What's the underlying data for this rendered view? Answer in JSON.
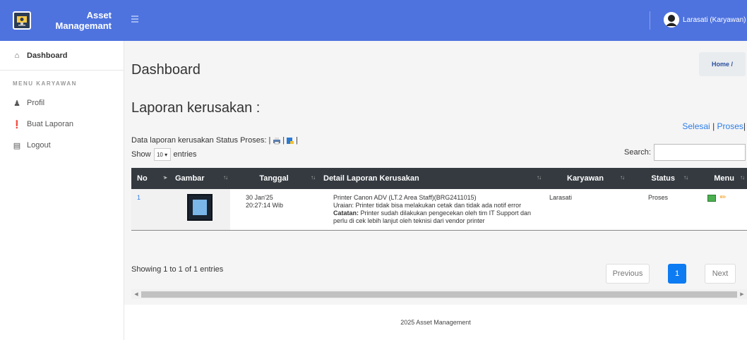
{
  "brand": {
    "line1": "Asset",
    "line2": "Managemant"
  },
  "user": {
    "name": "Larasati (Karyawan)"
  },
  "sidebar": {
    "dashboard": "Dashboard",
    "heading": "MENU KARYAWAN",
    "items": [
      {
        "label": "Profil",
        "icon": "user-icon"
      },
      {
        "label": "Buat Laporan",
        "icon": "info-icon"
      },
      {
        "label": "Logout",
        "icon": "chart-icon"
      }
    ]
  },
  "page": {
    "title": "Dashboard",
    "breadcrumb": "Home  /",
    "section_title": "Laporan kerusakan :",
    "status_links": {
      "selesai": "Selesai",
      "proses": "Proses"
    },
    "caption": "Data laporan kerusakan Status Proses: |",
    "show_label": "Show",
    "show_value": "10",
    "entries_label": "entries",
    "search_label": "Search:"
  },
  "table": {
    "headers": [
      "No",
      "Gambar",
      "Tanggal",
      "Detail Laporan Kerusakan",
      "Karyawan",
      "Status",
      "Menu"
    ],
    "rows": [
      {
        "no": "1",
        "date": "30 Jan'25",
        "time": "20:27:14 Wib",
        "detail_title": "Printer Canon ADV (LT.2 Area Staff)(BRG2411015)",
        "uraian_label": "Uraian:",
        "uraian": "Printer tidak bisa melakukan cetak dan tidak ada notif error",
        "catatan_label": "Catatan:",
        "catatan": "Printer sudah dilakukan pengecekan oleh tim IT Support dan perlu di cek lebih lanjut oleh teknisi dari vendor printer",
        "karyawan": "Larasati",
        "status": "Proses"
      }
    ]
  },
  "pagination": {
    "info": "Showing 1 to 1 of 1 entries",
    "previous": "Previous",
    "page": "1",
    "next": "Next"
  },
  "footer": {
    "text": "2025 Asset Management"
  },
  "colors": {
    "primary": "#4e73df",
    "table_header": "#343a40",
    "active_page": "#0d7bf2",
    "link": "#2b7de9"
  }
}
